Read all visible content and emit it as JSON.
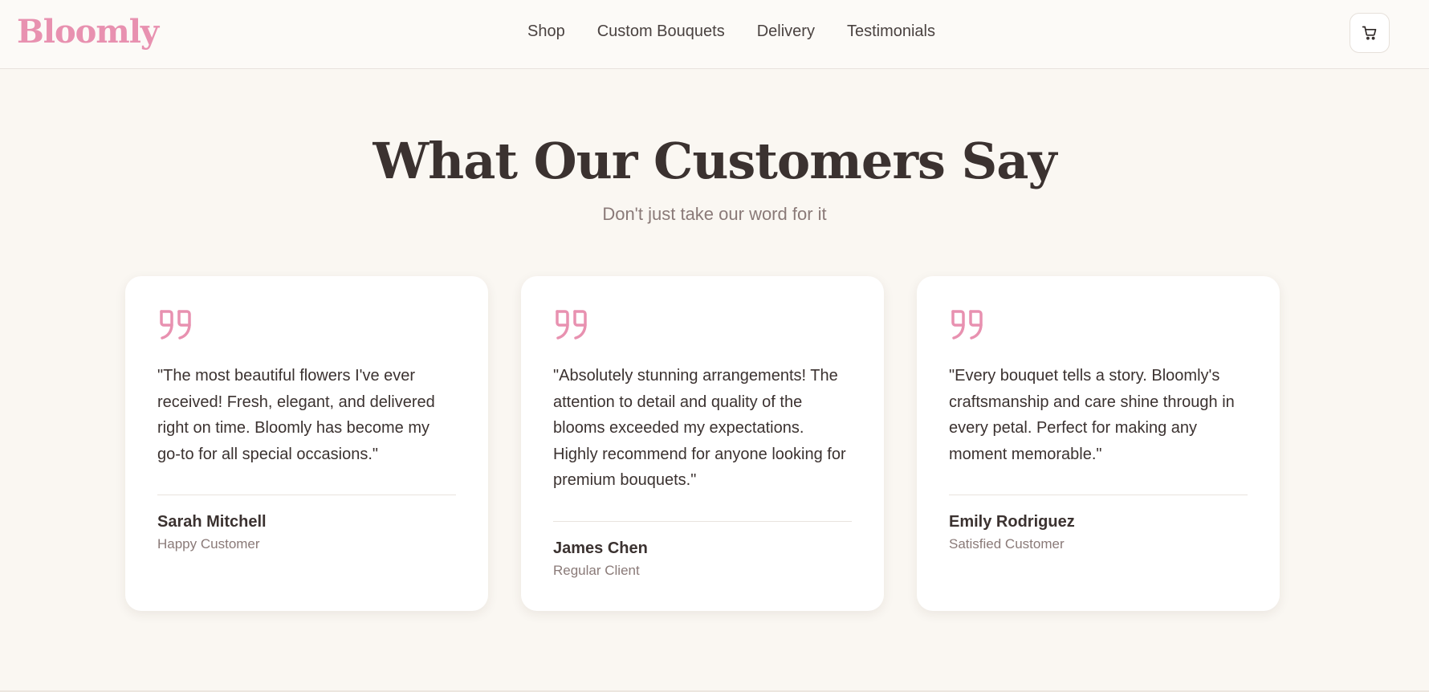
{
  "header": {
    "logo": "Bloomly",
    "nav": [
      "Shop",
      "Custom Bouquets",
      "Delivery",
      "Testimonials"
    ],
    "cart_icon": "cart-icon"
  },
  "section": {
    "title": "What Our Customers Say",
    "subtitle": "Don't just take our word for it"
  },
  "testimonials": [
    {
      "quote": "\"The most beautiful flowers I've ever received! Fresh, elegant, and delivered right on time. Bloomly has become my go-to for all special occasions.\"",
      "name": "Sarah Mitchell",
      "role": "Happy Customer"
    },
    {
      "quote": "\"Absolutely stunning arrangements! The attention to detail and quality of the blooms exceeded my expectations. Highly recommend for anyone looking for premium bouquets.\"",
      "name": "James Chen",
      "role": "Regular Client"
    },
    {
      "quote": "\"Every bouquet tells a story. Bloomly's craftsmanship and care shine through in every petal. Perfect for making any moment memorable.\"",
      "name": "Emily Rodriguez",
      "role": "Satisfied Customer"
    }
  ],
  "colors": {
    "accent": "#e891b0",
    "background": "#faf7f2",
    "text": "#3b3230",
    "muted": "#8a7a78"
  }
}
